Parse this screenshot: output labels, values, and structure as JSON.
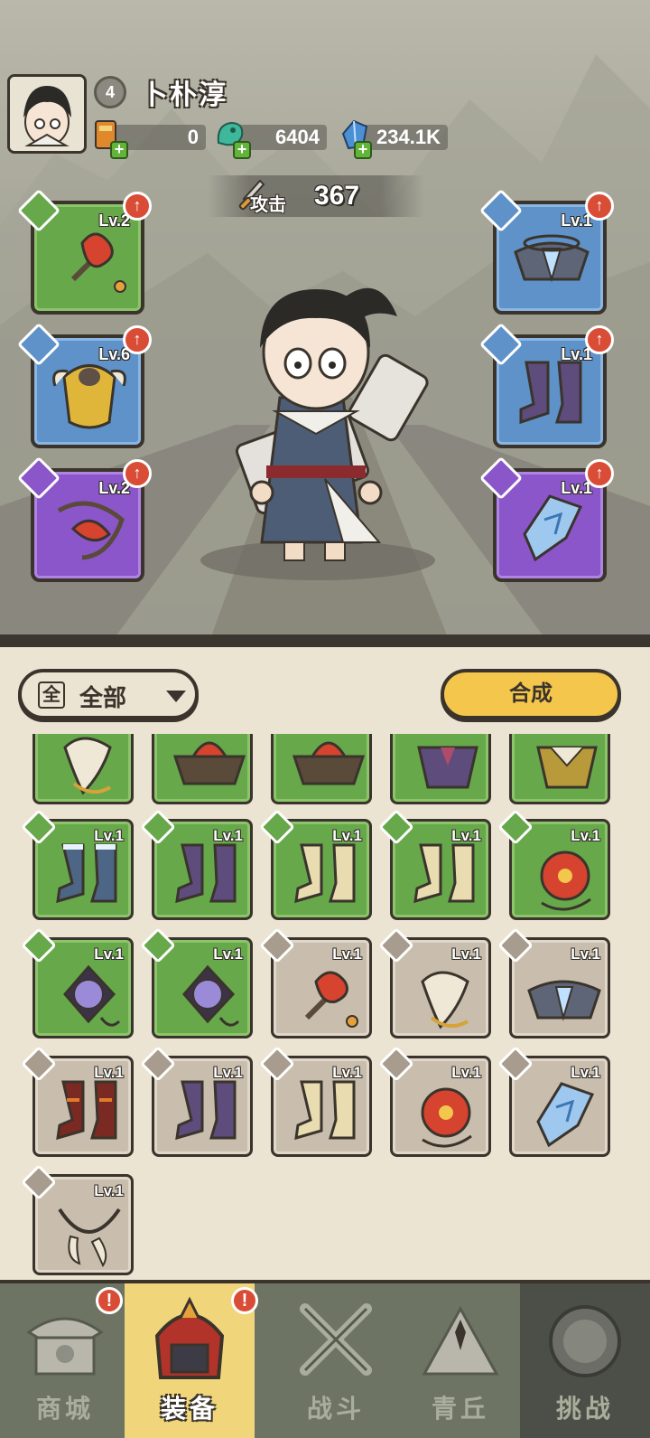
{
  "player": {
    "level": "4",
    "name": "卜朴淳"
  },
  "resources": [
    {
      "icon": "scroll-icon",
      "value": "0"
    },
    {
      "icon": "jade-dragon-icon",
      "value": "6404"
    },
    {
      "icon": "crystal-icon",
      "value": "234.1K"
    }
  ],
  "attack": {
    "label": "攻击",
    "value": "367"
  },
  "equipped": {
    "left": [
      {
        "slot": "weapon",
        "rarity": "green",
        "level": "Lv.2",
        "item": "red-flower-mace-icon"
      },
      {
        "slot": "armor",
        "rarity": "blue",
        "level": "Lv.6",
        "item": "golden-armor-icon"
      },
      {
        "slot": "accessory",
        "rarity": "purple",
        "level": "Lv.2",
        "item": "red-leaf-bow-icon"
      }
    ],
    "right": [
      {
        "slot": "shoulder",
        "rarity": "blue",
        "level": "Lv.1",
        "item": "ice-pauldron-icon"
      },
      {
        "slot": "boots",
        "rarity": "blue",
        "level": "Lv.1",
        "item": "violet-boots-icon"
      },
      {
        "slot": "amulet",
        "rarity": "purple",
        "level": "Lv.1",
        "item": "ice-crystal-pendant-icon"
      }
    ]
  },
  "filter": {
    "badge": "全",
    "label": "全部"
  },
  "merge_label": "合成",
  "inventory": [
    {
      "rarity": "green",
      "level": "",
      "item": "white-claw-icon",
      "partial": true
    },
    {
      "rarity": "green",
      "level": "",
      "item": "red-lotus-armor-icon",
      "partial": true
    },
    {
      "rarity": "green",
      "level": "",
      "item": "red-lotus-armor-icon",
      "partial": true
    },
    {
      "rarity": "green",
      "level": "",
      "item": "violet-armor-icon",
      "partial": true
    },
    {
      "rarity": "green",
      "level": "",
      "item": "gold-armor-icon",
      "partial": true
    },
    {
      "rarity": "green",
      "level": "Lv.1",
      "item": "ice-boots-icon"
    },
    {
      "rarity": "green",
      "level": "Lv.1",
      "item": "violet-boots-icon"
    },
    {
      "rarity": "green",
      "level": "Lv.1",
      "item": "bone-boots-icon"
    },
    {
      "rarity": "green",
      "level": "Lv.1",
      "item": "bone-boots-icon"
    },
    {
      "rarity": "green",
      "level": "Lv.1",
      "item": "red-orb-icon"
    },
    {
      "rarity": "green",
      "level": "Lv.1",
      "item": "violet-orb-icon"
    },
    {
      "rarity": "green",
      "level": "Lv.1",
      "item": "violet-orb-icon"
    },
    {
      "rarity": "grey",
      "level": "Lv.1",
      "item": "red-flower-mace-icon"
    },
    {
      "rarity": "grey",
      "level": "Lv.1",
      "item": "white-claw-icon"
    },
    {
      "rarity": "grey",
      "level": "Lv.1",
      "item": "ice-pauldron-icon"
    },
    {
      "rarity": "grey",
      "level": "Lv.1",
      "item": "flame-boots-icon"
    },
    {
      "rarity": "grey",
      "level": "Lv.1",
      "item": "violet-boots-icon"
    },
    {
      "rarity": "grey",
      "level": "Lv.1",
      "item": "bone-boots-icon"
    },
    {
      "rarity": "grey",
      "level": "Lv.1",
      "item": "red-orb-icon"
    },
    {
      "rarity": "grey",
      "level": "Lv.1",
      "item": "ice-crystal-pendant-icon"
    },
    {
      "rarity": "grey",
      "level": "Lv.1",
      "item": "fang-necklace-icon"
    }
  ],
  "nav": [
    {
      "label": "商城",
      "icon": "shop-icon",
      "alert": "!"
    },
    {
      "label": "装备",
      "icon": "helmet-icon",
      "alert": "!",
      "active": true
    },
    {
      "label": "战斗",
      "icon": "crossed-swords-icon"
    },
    {
      "label": "青丘",
      "icon": "mountain-icon"
    },
    {
      "label": "挑战",
      "icon": "challenge-orb-icon"
    }
  ],
  "colors": {
    "green": "#67a84b",
    "blue": "#5e92c9",
    "purple": "#8a56c9",
    "grey": "#c9beae",
    "accent": "#f4c64c",
    "alert": "#d94c36"
  }
}
